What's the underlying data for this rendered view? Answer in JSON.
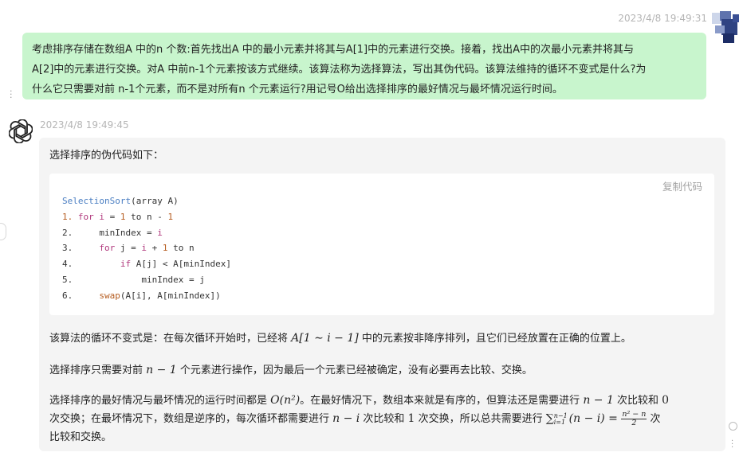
{
  "user_message": {
    "timestamp": "2023/4/8 19:49:31",
    "line1": "考虑排序存储在数组A 中的n 个数:首先找出A 中的最小元素并将其与A[1]中的元素进行交换。接着，找出A中的次最小元素并将其与",
    "line2": "A[2]中的元素进行交换。对A 中前n-1个元素按该方式继续。该算法称为选择算法，写出其伪代码。该算法维持的循环不变式是什么?为",
    "line3": "什么它只需要对前 n-1个元素，而不是对所有n 个元素运行?用记号O给出选择排序的最好情况与最坏情况运行时间。"
  },
  "bot_message": {
    "timestamp": "2023/4/8 19:49:45",
    "intro": "选择排序的伪代码如下：",
    "copy_label": "复制代码",
    "code": {
      "l0_fn": "SelectionSort",
      "l0_rest": "(array A)",
      "l1_num": "1.",
      "l1_kw": "for",
      "l1_var": "i",
      "l1_eq": " = ",
      "l1_one": "1",
      "l1_to": " to n - ",
      "l1_one2": "1",
      "l2_num": "2.",
      "l2_a": "minIndex = ",
      "l2_var": "i",
      "l3_num": "3.",
      "l3_kw": "for",
      "l3_a": " j = ",
      "l3_var": "i",
      "l3_b": " + ",
      "l3_one": "1",
      "l3_c": " to n",
      "l4_num": "4.",
      "l4_kw": "if",
      "l4_a": " A[j] < A[minIndex]",
      "l5_num": "5.",
      "l5_a": "minIndex = j",
      "l6_num": "6.",
      "l6_fn": "swap",
      "l6_a": "(A[i], A[minIndex])"
    },
    "p1_before": "该算法的循环不变式是：在每次循环开始时，已经将 ",
    "p1_math": "A[1 ∼ i − 1]",
    "p1_after": " 中的元素按非降序排列，且它们已经放置在正确的位置上。",
    "p2_before": "选择排序只需要对前 ",
    "p2_math": "n − 1",
    "p2_after": " 个元素进行操作，因为最后一个元素已经被确定，没有必要再去比较、交换。",
    "p3_a": "选择排序的最好情况与最坏情况的运行时间都是 ",
    "p3_math1": "O(n²)",
    "p3_b": "。在最好情况下，数组本来就是有序的，但算法还是需要进行 ",
    "p3_math2": "n − 1",
    "p3_c": " 次比较和 ",
    "p3_math3": "0",
    "p3_d": "次交换；在最坏情况下，数组是逆序的，每次循环都需要进行 ",
    "p3_math4": "n − i",
    "p3_e": " 次比较和 ",
    "p3_math5": "1",
    "p3_f": " 次交换，所以总共需要进行 ",
    "p3_sum_upper": "n−1",
    "p3_sum_lower": "i=1",
    "p3_sum_body": "(n − i) = ",
    "p3_frac_num": "n² − n",
    "p3_frac_den": "2",
    "p3_g": " 次",
    "p3_h": "比较和交换。"
  }
}
